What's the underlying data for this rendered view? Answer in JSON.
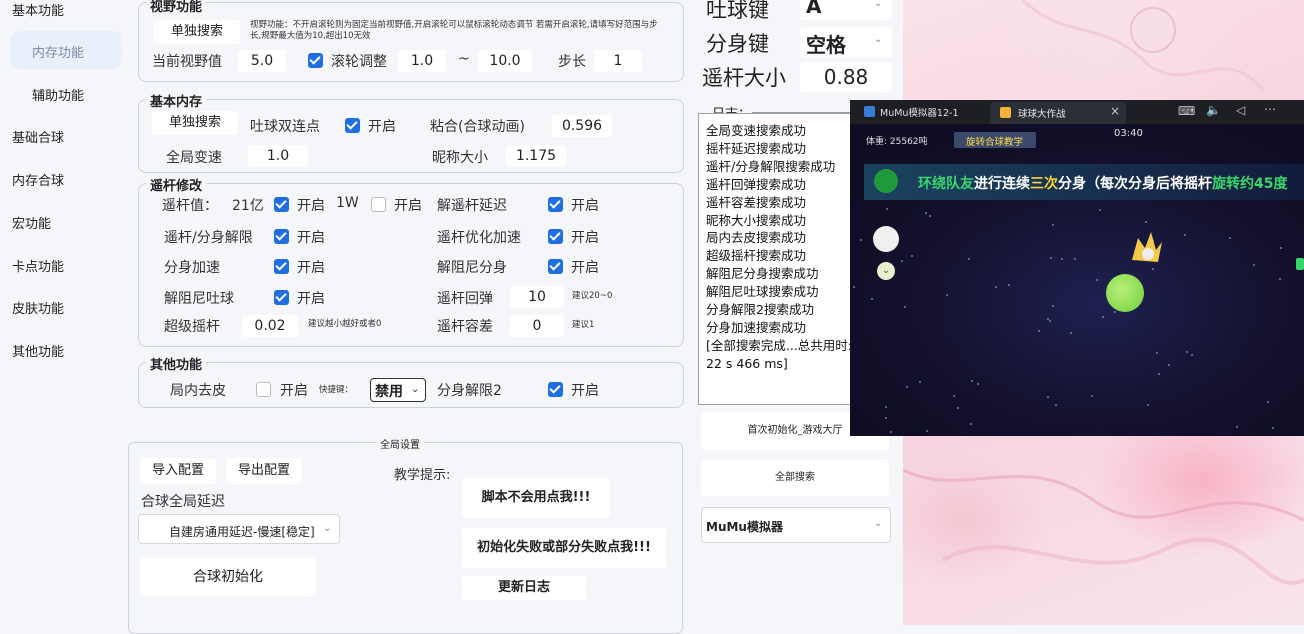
{
  "sidebar": {
    "items": [
      {
        "label": "基本功能"
      },
      {
        "label": "内存功能"
      },
      {
        "label": "辅助功能"
      },
      {
        "label": "基础合球"
      },
      {
        "label": "内存合球"
      },
      {
        "label": "宏功能"
      },
      {
        "label": "卡点功能"
      },
      {
        "label": "皮肤功能"
      },
      {
        "label": "其他功能"
      }
    ]
  },
  "vision": {
    "title": "视野功能",
    "search_btn": "单独搜索",
    "desc": "视野功能：不开启滚轮则为固定当前视野值,开启滚轮可以鼠标滚轮动态调节   若需开启滚轮,请填写好范围与步长,规野最大值为10,超出10无效",
    "current_label": "当前视野值",
    "current_value": "5.0",
    "wheel_label": "滚轮调整",
    "range_min": "1.0",
    "tilde": "~",
    "range_max": "10.0",
    "step_label": "步长",
    "step_value": "1"
  },
  "basic_memory": {
    "title": "基本内存",
    "search_btn": "单独搜索",
    "double_label": "吐球双连点",
    "enable_label": "开启",
    "sticky_label": "粘合(合球动画)",
    "sticky_value": "0.596",
    "global_speed_label": "全局变速",
    "global_speed_value": "1.0",
    "nickname_label": "昵称大小",
    "nickname_value": "1.175"
  },
  "joystick": {
    "title": "遥杆修改",
    "value_label": "遥杆值：",
    "v21": "21亿",
    "v1w": "1W",
    "enable": "开启",
    "unlock_delay": "解遥杆延迟",
    "split_unlimit": "遥杆/分身解限",
    "optimize": "遥杆优化加速",
    "split_speed": "分身加速",
    "damp_split": "解阻尼分身",
    "damp_spit": "解阻尼吐球",
    "rebound": "遥杆回弹",
    "rebound_value": "10",
    "rebound_hint": "建议20~0",
    "super_label": "超级摇杆",
    "super_value": "0.02",
    "super_hint": "建议越小越好或者0",
    "tolerance": "遥杆容差",
    "tolerance_value": "0",
    "tolerance_hint": "建议1"
  },
  "other": {
    "title": "其他功能",
    "skin_label": "局内去皮",
    "enable": "开启",
    "hotkey_label": "快捷键：",
    "hotkey_value": "禁用",
    "split_unlimit2": "分身解限2"
  },
  "global": {
    "title": "全局设置",
    "import_btn": "导入配置",
    "export_btn": "导出配置",
    "delay_label": "合球全局延迟",
    "delay_value": "自建房通用延迟-慢速[稳定]",
    "init_btn": "合球初始化",
    "tips_label": "教学提示:",
    "help1": "脚本不会用点我!!!",
    "help2": "初始化失败或部分失败点我!!!",
    "changelog": "更新日志"
  },
  "keys": {
    "spit_label": "吐球键",
    "spit_value": "A",
    "split_label": "分身键",
    "split_value": "空格",
    "joy_label": "遥杆大小",
    "joy_value": "0.88"
  },
  "log": {
    "title": "日志：",
    "lines": [
      "全局变速搜索成功",
      "摇杆延迟搜索成功",
      "遥杆/分身解限搜索成功",
      "遥杆回弹搜索成功",
      "遥杆容差搜索成功",
      "昵称大小搜索成功",
      "局内去皮搜索成功",
      "超级摇杆搜索成功",
      "解阻尼分身搜索成功",
      "解阻尼吐球搜索成功",
      "分身解限2搜索成功",
      "分身加速搜索成功",
      "[全部搜索完成...总共用时:22 s 466 ms]"
    ]
  },
  "actions": {
    "first_init": "首次初始化_游戏大厅",
    "search_all": "全部搜索",
    "emulator": "MuMu模拟器"
  },
  "game": {
    "tab1": "MuMu模拟器12-1",
    "tab2": "球球大作战",
    "close": "×",
    "time": "03:40",
    "weight": "体重: 25562吨",
    "tutorial": "旋转合球教学",
    "banner_a": "环绕队友",
    "banner_b": "进行连续",
    "banner_c": "三次",
    "banner_d": "分身（每次分身后将摇杆",
    "banner_e": "旋转约45度"
  },
  "colors": {
    "accent": "#1f6fe0",
    "banner_green": "#36d86a",
    "banner_yellow": "#f5d33a"
  }
}
